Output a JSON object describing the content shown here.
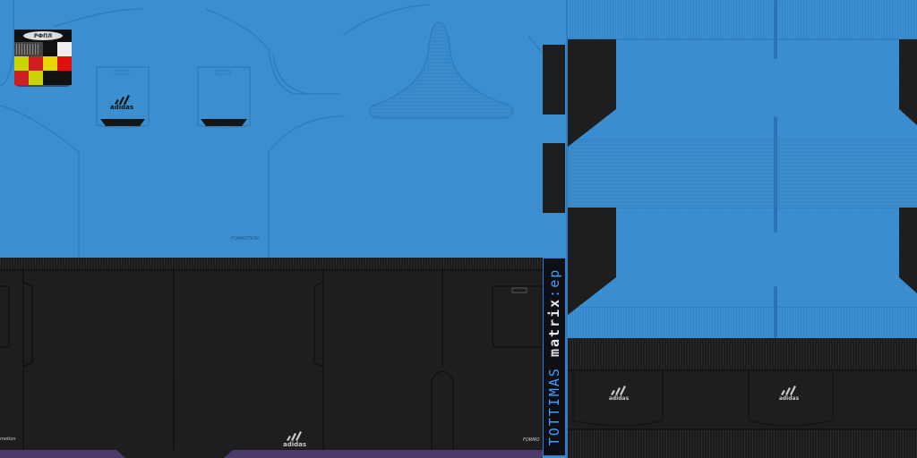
{
  "texture": {
    "colors": {
      "shirt_blue": "#3b8fd0",
      "seam_blue": "#2f7dbd",
      "dark": "#1e1e1e",
      "darker": "#151515",
      "purple": "#4a3a6a",
      "credit_blue": "#3fa0ff"
    },
    "brand": {
      "front_logo": "adidas",
      "shorts_logo": "adidas",
      "sock_logo_left": "adidas",
      "sock_logo_right": "adidas",
      "shirt_tech_label": "FORMOTION",
      "shorts_tech_label_left": "motion",
      "shorts_tech_label_right": "FORMO"
    },
    "badge": {
      "top_label": "РФПЛ",
      "swatches": [
        "#c9d400",
        "#d01f1f",
        "#e8d800",
        "#e01010",
        "#d01f1f",
        "#c9d400",
        "#111111",
        "#111111"
      ]
    },
    "credit": {
      "part_a": "TOTTIMAS",
      "part_b": "matrix",
      "part_c": ":ep"
    }
  }
}
